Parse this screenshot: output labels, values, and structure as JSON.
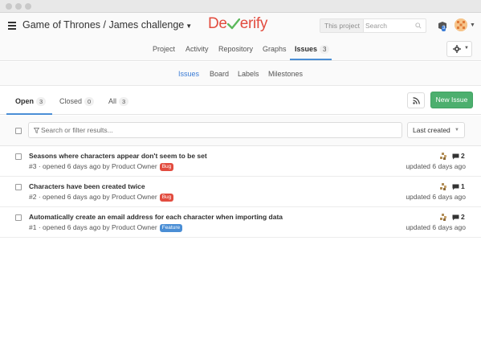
{
  "header": {
    "project_title": "Game of Thrones / James challenge",
    "logo_left": "De",
    "logo_right": "erify",
    "search_scope": "This project",
    "search_placeholder": "Search",
    "todo_count": "3"
  },
  "project_nav": {
    "items": [
      {
        "label": "Project"
      },
      {
        "label": "Activity"
      },
      {
        "label": "Repository"
      },
      {
        "label": "Graphs"
      },
      {
        "label": "Issues",
        "count": "3"
      }
    ]
  },
  "sub_nav": {
    "items": [
      {
        "label": "Issues"
      },
      {
        "label": "Board"
      },
      {
        "label": "Labels"
      },
      {
        "label": "Milestones"
      }
    ]
  },
  "state_tabs": [
    {
      "label": "Open",
      "count": "3"
    },
    {
      "label": "Closed",
      "count": "0"
    },
    {
      "label": "All",
      "count": "3"
    }
  ],
  "buttons": {
    "new_issue": "New Issue"
  },
  "filter": {
    "placeholder": "Search or filter results...",
    "sort_label": "Last created"
  },
  "issues": [
    {
      "title": "Seasons where characters appear don't seem to be set",
      "meta": "#3 · opened 6 days ago by Product Owner",
      "label": "Bug",
      "label_color": "#e24c3f",
      "comments": "2",
      "updated": "updated 6 days ago"
    },
    {
      "title": "Characters have been created twice",
      "meta": "#2 · opened 6 days ago by Product Owner",
      "label": "Bug",
      "label_color": "#e24c3f",
      "comments": "1",
      "updated": "updated 6 days ago"
    },
    {
      "title": "Automatically create an email address for each character when importing data",
      "meta": "#1 · opened 6 days ago by Product Owner",
      "label": "Feature",
      "label_color": "#4a8ed5",
      "comments": "2",
      "updated": "updated 6 days ago"
    }
  ],
  "colors": {
    "accent_blue": "#3a7bd5",
    "new_issue_green": "#4caf6e",
    "logo_red": "#e24c3f",
    "logo_check_green": "#5cb85c"
  }
}
